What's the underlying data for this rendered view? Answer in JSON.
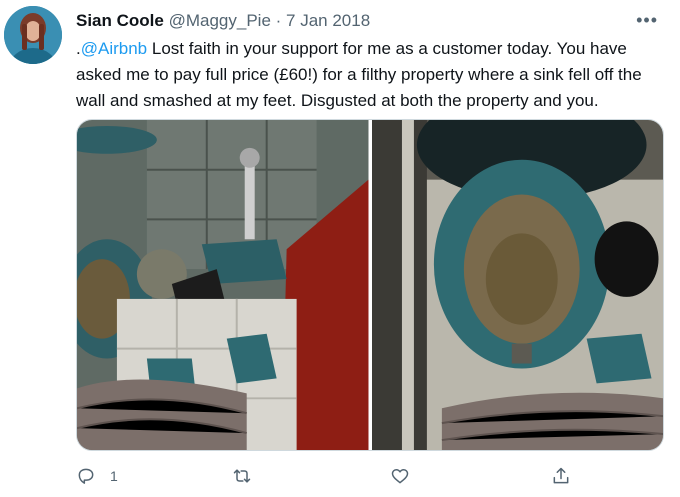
{
  "tweet": {
    "author_name": "Sian Coole",
    "author_handle": "@Maggy_Pie",
    "separator": "·",
    "date": "7 Jan 2018",
    "text_prefix": ".",
    "mention": "@Airbnb",
    "text_body": " Lost faith in your support for me as a customer today. You have asked me to pay full price (£60!) for a filthy property where a sink fell off the wall and smashed at my feet. Disgusted at both the property and you.",
    "photos": [
      {
        "icon": "photo-broken-sink-floor"
      },
      {
        "icon": "photo-dirty-toilet"
      }
    ]
  },
  "actions": {
    "reply": {
      "icon": "reply-icon",
      "count": "1"
    },
    "retweet": {
      "icon": "retweet-icon",
      "count": ""
    },
    "like": {
      "icon": "like-icon",
      "count": ""
    },
    "share": {
      "icon": "share-icon",
      "count": ""
    }
  },
  "more_menu": {
    "icon": "more-icon",
    "glyph": "•••"
  },
  "colors": {
    "text": "#0f1419",
    "secondary": "#536471",
    "link": "#1d9bf0",
    "border": "#cfd9de"
  }
}
